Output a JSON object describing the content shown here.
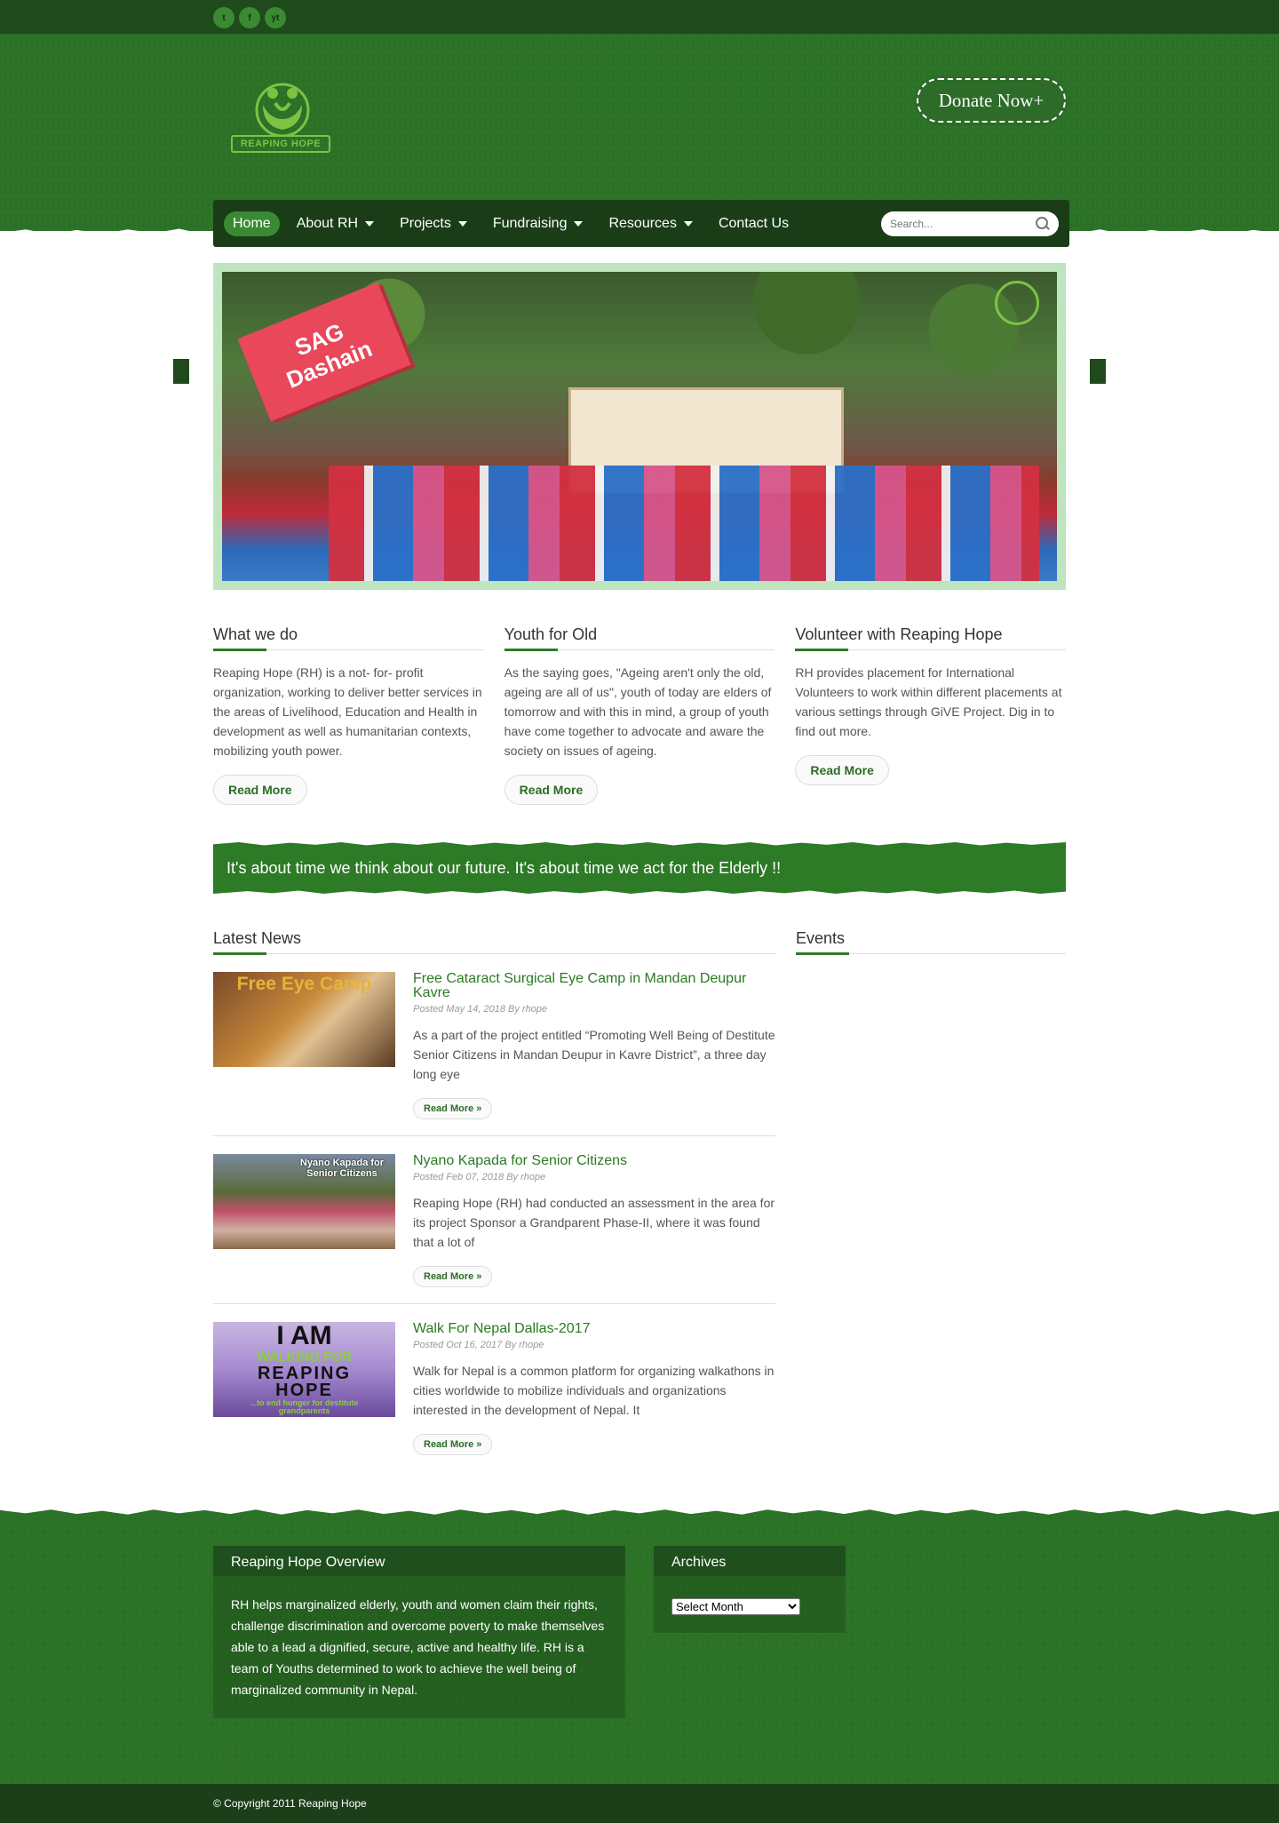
{
  "social": [
    {
      "label": "t",
      "name": "twitter-icon"
    },
    {
      "label": "f",
      "name": "facebook-icon"
    },
    {
      "label": "yt",
      "name": "youtube-icon"
    }
  ],
  "header": {
    "logo_text": "REAPING HOPE",
    "donate_label": "Donate Now+"
  },
  "nav": {
    "items": [
      {
        "label": "Home",
        "active": true,
        "dropdown": false
      },
      {
        "label": "About RH",
        "dropdown": true
      },
      {
        "label": "Projects",
        "dropdown": true
      },
      {
        "label": "Fundraising",
        "dropdown": true
      },
      {
        "label": "Resources",
        "dropdown": true
      },
      {
        "label": "Contact Us",
        "dropdown": false
      }
    ],
    "search_placeholder": "Search..."
  },
  "slider": {
    "badge_line1": "SAG",
    "badge_line2": "Dashain"
  },
  "columns": [
    {
      "title": "What we do",
      "text": "Reaping Hope (RH) is a not- for- profit organization, working to deliver better services in the areas of Livelihood, Education and Health in development as well as humanitarian contexts, mobilizing youth power.",
      "button": "Read More"
    },
    {
      "title": "Youth for Old",
      "text": "As the saying goes, \"Ageing aren't only the old, ageing are all of us\", youth of today are elders of tomorrow and with this in mind, a group of youth have come together to advocate and aware the society on issues of ageing.",
      "button": "Read More"
    },
    {
      "title": "Volunteer with Reaping Hope",
      "text": "RH provides placement for International Volunteers to work within different placements at various settings through GiVE Project. Dig in to find out more.",
      "button": "Read More"
    }
  ],
  "strip_text": "It's about time we think about our future. It's about time we act for the Elderly !!",
  "news": {
    "title": "Latest News",
    "posts": [
      {
        "title": "Free Cataract Surgical Eye Camp in Mandan Deupur Kavre",
        "meta": "Posted May 14, 2018 By rhope",
        "excerpt": "As a part of the project entitled “Promoting Well Being of Destitute Senior Citizens in Mandan Deupur in Kavre District”, a three day long eye",
        "button": "Read More »",
        "thumb_text": "Free Eye Camp"
      },
      {
        "title": "Nyano Kapada for Senior Citizens",
        "meta": "Posted Feb 07, 2018 By rhope",
        "excerpt": "Reaping Hope (RH) had conducted an assessment in the area for its project Sponsor a Grandparent Phase-II, where it was found that a lot of",
        "button": "Read More »",
        "thumb_text": "Nyano Kapada for Senior Citizens"
      },
      {
        "title": "Walk For Nepal Dallas-2017",
        "meta": "Posted Oct 16, 2017 By rhope",
        "excerpt": "Walk for Nepal is a common platform for organizing walkathons in cities worldwide to mobilize individuals and organizations interested in the development of Nepal. It",
        "button": "Read More »",
        "thumb_text_1": "I AM",
        "thumb_text_2": "WALKING FOR",
        "thumb_text_3": "REAPING",
        "thumb_text_4": "HOPE",
        "thumb_text_5": "...to end hunger for destitute grandparents"
      }
    ]
  },
  "events": {
    "title": "Events"
  },
  "footer": {
    "overview_title": "Reaping Hope Overview",
    "overview_text": "RH helps marginalized elderly, youth and women claim their rights, challenge discrimination and overcome poverty to make themselves able to a lead a dignified, secure, active and healthy life. RH is a team of Youths determined to work to achieve the well being of marginalized community in Nepal.",
    "archives_title": "Archives",
    "archives_select": "Select Month",
    "copyright": "© Copyright 2011 Reaping Hope"
  }
}
